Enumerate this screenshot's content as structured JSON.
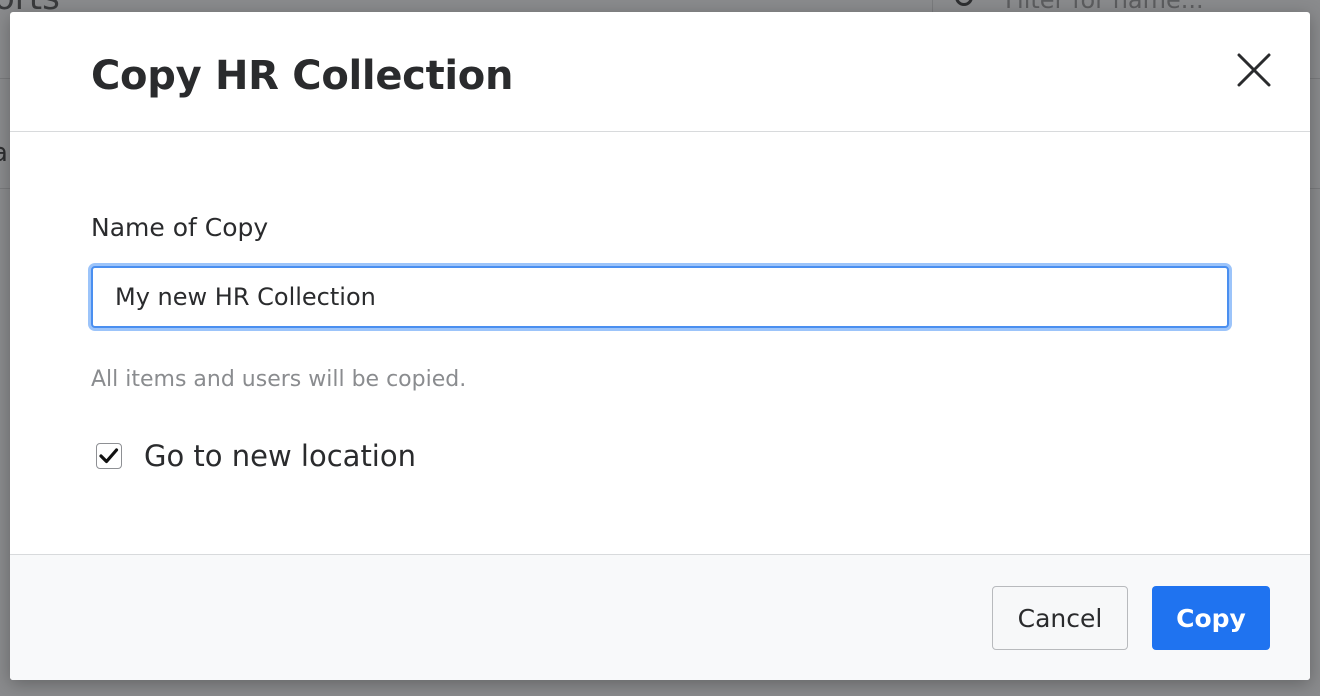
{
  "background": {
    "page_title": "orts",
    "filter_placeholder": "Filter for name...",
    "row_fragment": "a"
  },
  "dialog": {
    "title": "Copy HR Collection",
    "close_icon": "close-icon",
    "name_label": "Name of Copy",
    "name_value": "My new HR Collection",
    "helper_text": "All items and users will be copied.",
    "go_to_location": {
      "label": "Go to new location",
      "checked": true
    },
    "cancel_label": "Cancel",
    "copy_label": "Copy"
  },
  "colors": {
    "primary": "#1f73f0",
    "focus_ring": "#9cc4fa",
    "overlay": "#8a8b8d"
  }
}
